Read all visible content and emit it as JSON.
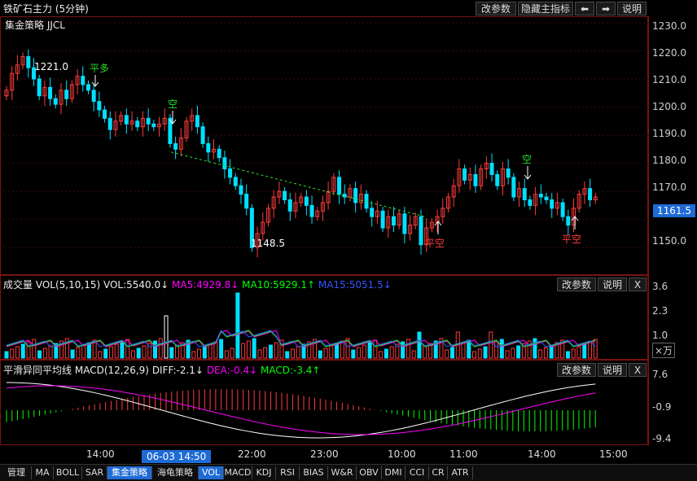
{
  "title": "铁矿石主力 (5分钟)",
  "toolbar": {
    "params": "改参数",
    "hide_indicator": "隐藏主指标",
    "back": "⬅",
    "forward": "➡",
    "help": "说明"
  },
  "main_panel": {
    "strategy_label": "集金策略 JJCL",
    "y_ticks": [
      "1230.0",
      "1220.0",
      "1210.0",
      "1200.0",
      "1190.0",
      "1180.0",
      "1170.0",
      "1160.0",
      "1150.0"
    ],
    "current_price": "1161.5",
    "high_label": "1221.0",
    "low_label": "1148.5",
    "signals": {
      "ping_duo": "平多",
      "kong1": "空",
      "kong2": "空",
      "ping_kong1": "平空",
      "ping_kong2": "平空"
    }
  },
  "vol_panel": {
    "name": "成交量",
    "params": "VOL(5,10,15)",
    "vol": "VOL:5540.0↓",
    "ma5": "MA5:4929.8↓",
    "ma10": "MA10:5929.1↑",
    "ma15": "MA15:5051.5↓",
    "btn_params": "改参数",
    "btn_help": "说明",
    "btn_close": "X",
    "y_ticks": [
      "3.6",
      "2.3",
      "1.0"
    ],
    "unit": "×万"
  },
  "macd_panel": {
    "name": "平滑异同平均线",
    "params": "MACD(12,26,9)",
    "diff": "DIFF:-2.1↓",
    "dea": "DEA:-0.4↓",
    "macd": "MACD:-3.4↑",
    "btn_params": "改参数",
    "btn_help": "说明",
    "btn_close": "X",
    "y_ticks": [
      "7.6",
      "-0.9",
      "-9.4"
    ]
  },
  "time_axis": {
    "labels": [
      "14:00",
      "22:00",
      "23:00",
      "10:00",
      "11:00",
      "14:00",
      "15:00"
    ],
    "cursor": "06-03 14:50"
  },
  "tabs": [
    "管理",
    "MA",
    "BOLL",
    "SAR",
    "集金策略",
    "海龟策略",
    "VOL",
    "MACD",
    "KDJ",
    "RSI",
    "BIAS",
    "W&R",
    "OBV",
    "DMI",
    "CCI",
    "CR",
    "ATR"
  ],
  "colors": {
    "up": "#ff3b3b",
    "down": "#00e0ff",
    "ma5": "#ff00ff",
    "ma10": "#00ff00",
    "ma15": "#3355ff",
    "accent": "#1e6bd6",
    "border": "#7a1111"
  }
}
